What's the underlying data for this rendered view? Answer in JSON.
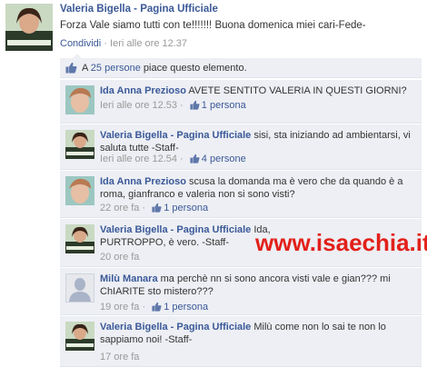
{
  "post": {
    "author": "Valeria Bigella - Pagina Ufficiale",
    "text": "Forza Vale siamo tutti con te!!!!!!! Buona domenica miei cari-Fede-",
    "share": "Condividi",
    "sep": " · ",
    "time": "Ieri alle ore 12.37"
  },
  "likes": {
    "prefix": "A ",
    "people": "25 persone",
    "suffix": " piace questo elemento."
  },
  "comments": [
    {
      "author": "Ida Anna Prezioso",
      "text": "AVETE SENTITO VALERIA IN QUESTI GIORNI?",
      "time": "Ieri alle ore 12.53",
      "sep": " · ",
      "likes": "1 persona"
    },
    {
      "author": "Valeria Bigella - Pagina Ufficiale",
      "text": "sisi, sta iniziando ad ambientarsi, vi saluta tutte -Staff-",
      "time": "Ieri alle ore 12.54",
      "sep": " · ",
      "likes": "4 persone"
    },
    {
      "author": "Ida Anna Prezioso",
      "text": "scusa la domanda ma è vero che da quando è a roma, gianfranco e valeria non si sono visti?",
      "time": "22 ore fa",
      "sep": " · ",
      "likes": "1 persona"
    },
    {
      "author": "Valeria Bigella - Pagina Ufficiale",
      "text": "Ida, PURTROPPO, è vero. -Staff-",
      "time": "20 ore fa",
      "sep": "",
      "likes": ""
    },
    {
      "author": "Milù Manara",
      "text": "ma perchè nn si sono ancora visti vale e gian??? mi ChIARITE sto mistero???",
      "time": "19 ore fa",
      "sep": " · ",
      "likes": "1 persona"
    },
    {
      "author": "Valeria Bigella - Pagina Ufficiale",
      "text": "Milù come non lo sai te non lo sappiamo noi! -Staff-",
      "time": "17 ore fa",
      "sep": "",
      "likes": ""
    }
  ],
  "watermark": "www.isaechia.it",
  "icons": {
    "like": "thumbs-up-icon",
    "avatar_page": "valeria-photo",
    "avatar_ida": "ida-photo",
    "avatar_default": "default-silhouette"
  },
  "colors": {
    "link": "#3b5998",
    "comment_bg": "#edeff4",
    "meta": "#999999",
    "watermark": "#e2201a"
  }
}
